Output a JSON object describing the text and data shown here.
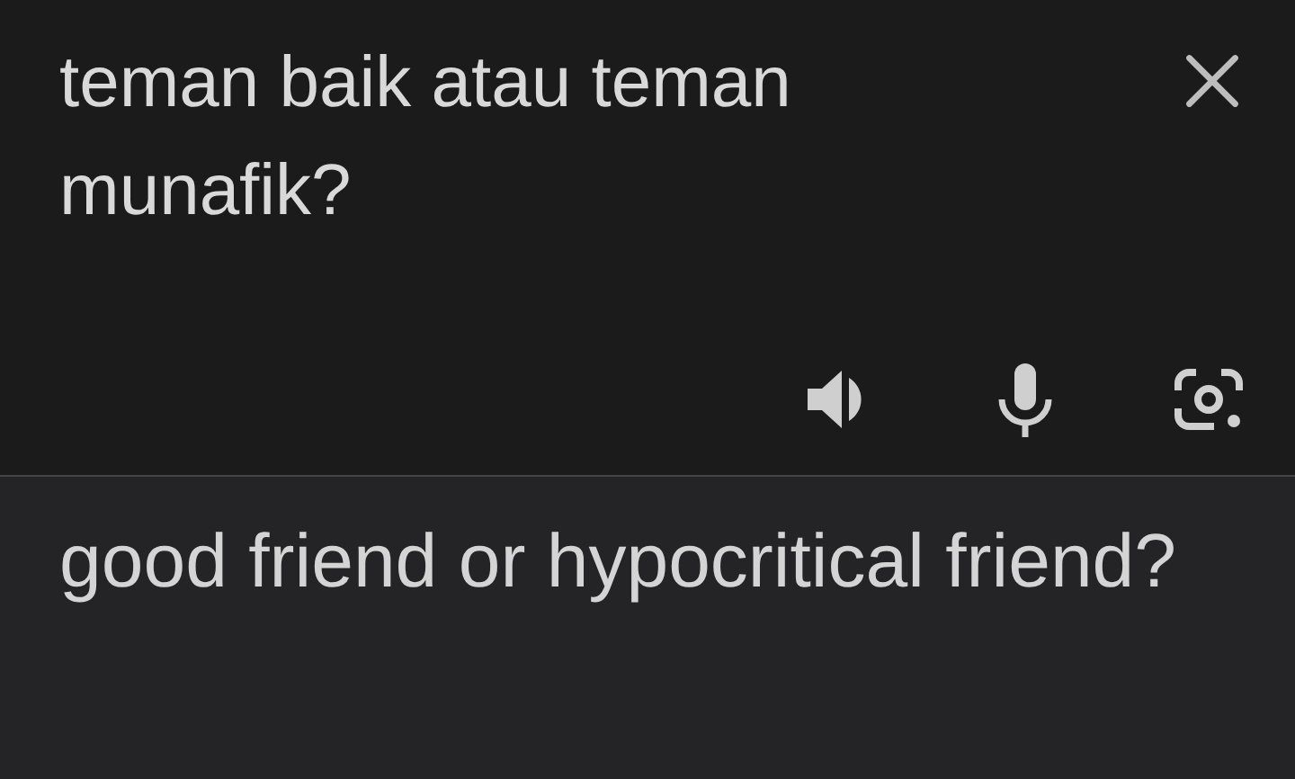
{
  "source": {
    "text": "teman baik atau teman munafik?"
  },
  "translation": {
    "text": "good friend or hypocritical friend?"
  }
}
